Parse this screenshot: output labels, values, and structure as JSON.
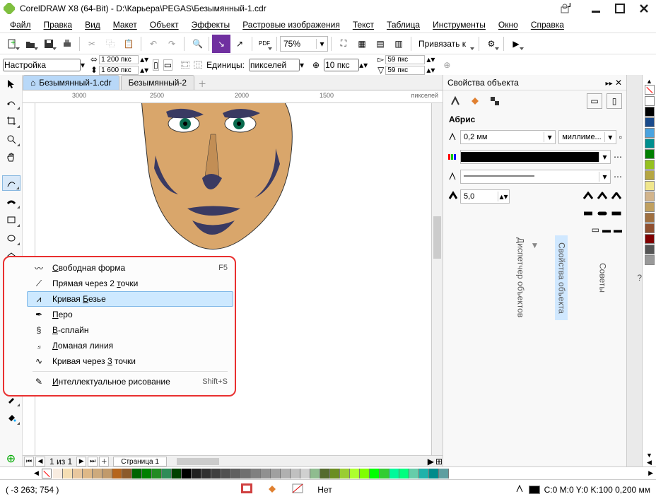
{
  "title": "CorelDRAW X8 (64-Bit) - D:\\Карьера\\PEGAS\\Безымянный-1.cdr",
  "menu": [
    "Файл",
    "Правка",
    "Вид",
    "Макет",
    "Объект",
    "Эффекты",
    "Растровые изображения",
    "Текст",
    "Таблица",
    "Инструменты",
    "Окно",
    "Справка"
  ],
  "toolbar1": {
    "zoom": "75%",
    "snap_label": "Привязать к"
  },
  "propbar": {
    "preset": "Настройка",
    "width": "1 200 пкс",
    "height": "1 600 пкс",
    "units_label": "Единицы:",
    "units": "пикселей",
    "nudge": "10 пкс",
    "dupx": "59 пкс",
    "dupy": "59 пкс"
  },
  "doctabs": {
    "tab1": "Безымянный-1.cdr",
    "tab2": "Безымянный-2"
  },
  "ruler": {
    "t1": "3000",
    "t2": "2500",
    "t3": "2000",
    "t4": "1500",
    "unit": "пикселей"
  },
  "flyout": {
    "items": [
      {
        "label_pre": "",
        "u": "С",
        "label": "вободная форма",
        "shortcut": "F5"
      },
      {
        "label_pre": "Прямая через 2 ",
        "u": "т",
        "label": "очки",
        "shortcut": ""
      },
      {
        "label_pre": "Кривая ",
        "u": "Б",
        "label": "езье",
        "shortcut": ""
      },
      {
        "label_pre": "",
        "u": "П",
        "label": "еро",
        "shortcut": ""
      },
      {
        "label_pre": "",
        "u": "B",
        "label": "-сплайн",
        "shortcut": ""
      },
      {
        "label_pre": "",
        "u": "Л",
        "label": "оманая линия",
        "shortcut": ""
      },
      {
        "label_pre": "Кривая через ",
        "u": "3",
        "label": " точки",
        "shortcut": ""
      },
      {
        "label_pre": "",
        "u": "И",
        "label": "нтеллектуальное рисование",
        "shortcut": "Shift+S"
      }
    ]
  },
  "docker": {
    "title": "Свойства объекта",
    "section": "Абрис",
    "outline_width": "0,2 мм",
    "outline_unit": "миллиме...",
    "miter": "5,0"
  },
  "sidetabs": {
    "t1": "Советы",
    "t2": "Свойства объекта",
    "t3": "Диспетчер объектов"
  },
  "pagebar": {
    "page_of": "1 из 1",
    "page_tab": "Страница 1"
  },
  "status": {
    "coords": "( -3 263; 754 )",
    "none": "Нет",
    "fill": "C:0 M:0 Y:0 K:100  0,200 мм"
  },
  "palette_right": [
    "#ffffff",
    "#000000",
    "#1a4b8c",
    "#4aa3df",
    "#008f8f",
    "#008000",
    "#95c11f",
    "#b5a642",
    "#f0e68c",
    "#d2b48c",
    "#c0a060",
    "#a07040",
    "#905030",
    "#800000",
    "#555555",
    "#999999"
  ],
  "palette_bottom": [
    "#f8ece0",
    "#f5deb3",
    "#e8c79e",
    "#deb887",
    "#cdaa7d",
    "#c19a6b",
    "#b5651d",
    "#8b5a2b",
    "#006400",
    "#008000",
    "#228b22",
    "#2e8b57",
    "#004000",
    "#000000",
    "#202020",
    "#303030",
    "#404040",
    "#505050",
    "#606060",
    "#707070",
    "#808080",
    "#909090",
    "#a0a0a0",
    "#b0b0b0",
    "#c0c0c0",
    "#d0d0d0",
    "#8fbc8f",
    "#556b2f",
    "#6b8e23",
    "#9acd32",
    "#adff2f",
    "#7fff00",
    "#00ff00",
    "#32cd32",
    "#00fa9a",
    "#00ff7f",
    "#66cdaa",
    "#20b2aa",
    "#008b8b",
    "#5f9ea0"
  ]
}
